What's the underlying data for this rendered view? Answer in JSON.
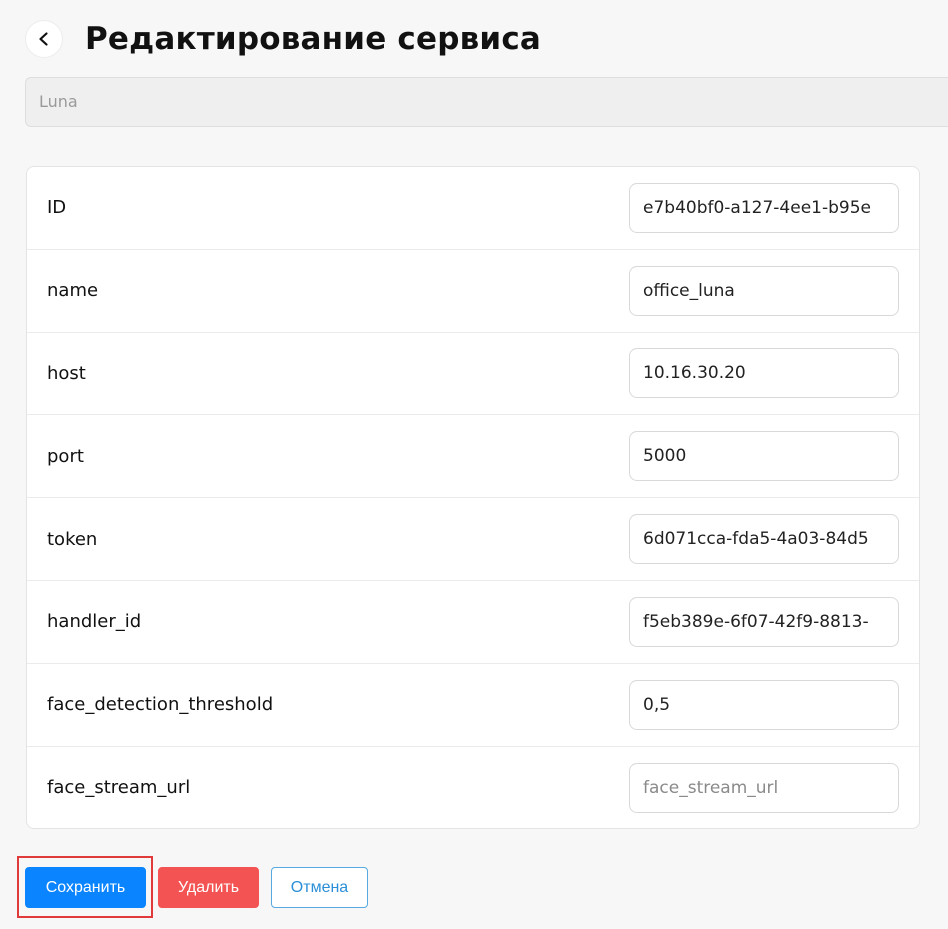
{
  "header": {
    "back_icon": "chevron-left-icon",
    "title": "Редактирование сервиса"
  },
  "service_type": {
    "value": "Luna"
  },
  "fields": [
    {
      "label": "ID",
      "value": "e7b40bf0-a127-4ee1-b95e",
      "placeholder": ""
    },
    {
      "label": "name",
      "value": "office_luna",
      "placeholder": ""
    },
    {
      "label": "host",
      "value": "10.16.30.20",
      "placeholder": ""
    },
    {
      "label": "port",
      "value": "5000",
      "placeholder": ""
    },
    {
      "label": "token",
      "value": "6d071cca-fda5-4a03-84d5",
      "placeholder": ""
    },
    {
      "label": "handler_id",
      "value": "f5eb389e-6f07-42f9-8813-",
      "placeholder": ""
    },
    {
      "label": "face_detection_threshold",
      "value": "0,5",
      "placeholder": ""
    },
    {
      "label": "face_stream_url",
      "value": "",
      "placeholder": "face_stream_url"
    }
  ],
  "actions": {
    "save_label": "Сохранить",
    "delete_label": "Удалить",
    "cancel_label": "Отмена"
  },
  "colors": {
    "primary": "#0a84ff",
    "danger": "#f45353",
    "highlight": "#e03a3a"
  }
}
